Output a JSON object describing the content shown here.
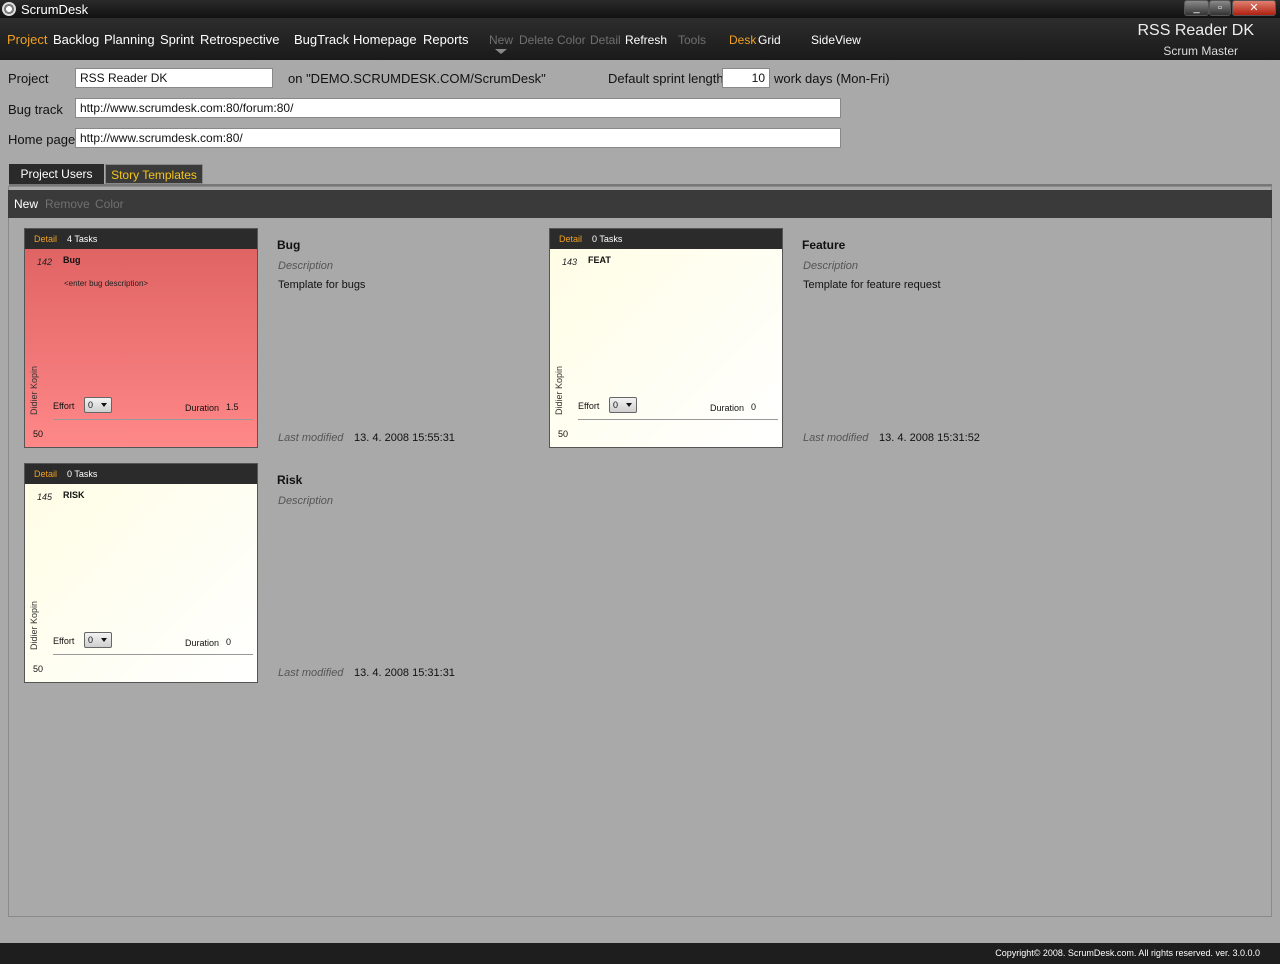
{
  "window": {
    "title": "ScrumDesk",
    "min": "_",
    "max": "▫",
    "close": "✕"
  },
  "menu": {
    "items": [
      "Project",
      "Backlog",
      "Planning",
      "Sprint",
      "Retrospective",
      "BugTrack",
      "Homepage",
      "Reports"
    ],
    "actions": [
      "New",
      "Delete",
      "Color",
      "Detail",
      "Refresh",
      "Tools"
    ],
    "views": [
      "Desk",
      "Grid",
      "SideView"
    ],
    "project_name": "RSS Reader DK",
    "role": "Scrum Master"
  },
  "form": {
    "project_label": "Project",
    "project_value": "RSS Reader DK",
    "server_text": "on \"DEMO.SCRUMDESK.COM/ScrumDesk\"",
    "sprint_label": "Default sprint length",
    "sprint_value": "10",
    "sprint_unit": "work days (Mon-Fri)",
    "bugtrack_label": "Bug track",
    "bugtrack_value": "http://www.scrumdesk.com:80/forum:80/",
    "homepage_label": "Home page",
    "homepage_value": "http://www.scrumdesk.com:80/"
  },
  "tabs": [
    "Project Users",
    "Story Templates"
  ],
  "toolbar": [
    "New",
    "Remove",
    "Color"
  ],
  "templates": [
    {
      "card": {
        "detail": "Detail",
        "tasks": "4 Tasks",
        "id": "142",
        "title": "Bug",
        "description": "<enter bug description>",
        "owner": "Didier Kopin",
        "effort_label": "Effort",
        "effort": "0",
        "duration_label": "Duration",
        "duration": "1.5",
        "points": "50",
        "color": "#ee7070"
      },
      "name": "Bug",
      "description_label": "Description",
      "description": "Template for bugs",
      "modified_label": "Last modified",
      "modified": "13. 4. 2008 15:55:31"
    },
    {
      "card": {
        "detail": "Detail",
        "tasks": "0 Tasks",
        "id": "143",
        "title": "FEAT",
        "description": "",
        "owner": "Didier Kopin",
        "effort_label": "Effort",
        "effort": "0",
        "duration_label": "Duration",
        "duration": "0",
        "points": "50",
        "color": "#fffde4"
      },
      "name": "Feature",
      "description_label": "Description",
      "description": "Template for feature request",
      "modified_label": "Last modified",
      "modified": "13. 4. 2008 15:31:52"
    },
    {
      "card": {
        "detail": "Detail",
        "tasks": "0 Tasks",
        "id": "145",
        "title": "RISK",
        "description": "",
        "owner": "Didier Kopin",
        "effort_label": "Effort",
        "effort": "0",
        "duration_label": "Duration",
        "duration": "0",
        "points": "50",
        "color": "#fffde4"
      },
      "name": "Risk",
      "description_label": "Description",
      "description": "",
      "modified_label": "Last modified",
      "modified": "13. 4. 2008 15:31:31"
    }
  ],
  "footer": {
    "copyright": "Copyright© 2008. ScrumDesk.com. All rights reserved. ver. 3.0.0.0"
  },
  "colors": {
    "accent": "#f0a020",
    "tab_active": "#f5c518",
    "menubar": "#1e1e1e",
    "background": "#a9a9a9"
  }
}
